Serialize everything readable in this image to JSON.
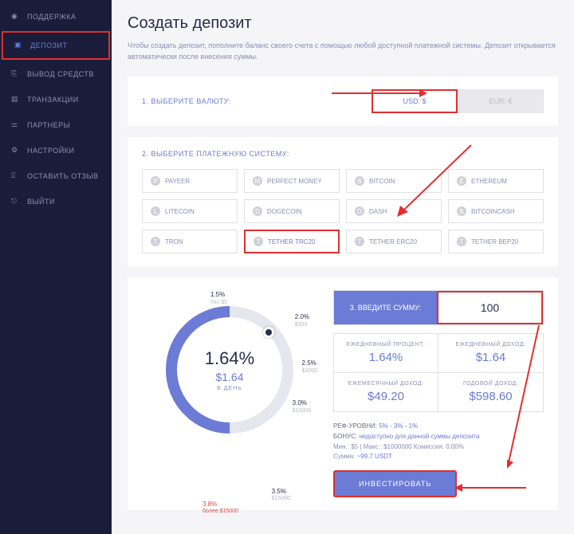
{
  "sidebar": {
    "items": [
      {
        "label": "ПОДДЕРЖКА",
        "icon": "headset"
      },
      {
        "label": "ДЕПОЗИТ",
        "icon": "deposit",
        "active": true
      },
      {
        "label": "ВЫВОД СРЕДСТВ",
        "icon": "withdraw"
      },
      {
        "label": "ТРАНЗАКЦИИ",
        "icon": "transactions"
      },
      {
        "label": "ПАРТНЕРЫ",
        "icon": "partners"
      },
      {
        "label": "НАСТРОЙКИ",
        "icon": "settings"
      },
      {
        "label": "ОСТАВИТЬ ОТЗЫВ",
        "icon": "review"
      },
      {
        "label": "ВЫЙТИ",
        "icon": "logout"
      }
    ]
  },
  "page": {
    "title": "Создать депозит",
    "subtitle": "Чтобы создать депозит, пополните баланс своего счета с помощью любой доступной платежной системы. Депозит открывается автоматически после внесения суммы."
  },
  "step1": {
    "label": "1. ВЫБЕРИТЕ ВАЛЮТУ:",
    "usd": "USD: $",
    "eur": "EUR: €"
  },
  "step2": {
    "label": "2. ВЫБЕРИТЕ ПЛАТЕЖНУЮ СИСТЕМУ:",
    "items": [
      "PAYEER",
      "PERFECT MONEY",
      "BITCOIN",
      "ETHEREUM",
      "LITECOIN",
      "DOGECOIN",
      "DASH",
      "BITCOINCASH",
      "TRON",
      "TETHER TRC20",
      "TETHER ERC20",
      "TETHER BEP20"
    ],
    "icons": [
      "P",
      "M",
      "B",
      "E",
      "L",
      "D",
      "D",
      "B",
      "T",
      "T",
      "T",
      "T"
    ],
    "selected_index": 9
  },
  "step3": {
    "label": "3. ВВЕДИТЕ СУММУ:",
    "amount": "100"
  },
  "gauge": {
    "percent": "1.64%",
    "amount": "$1.64",
    "per_day": "В ДЕНЬ",
    "ticks": [
      {
        "p": "1.5%",
        "v": "min $5"
      },
      {
        "p": "2.0%",
        "v": "$300"
      },
      {
        "p": "2.5%",
        "v": "$3000"
      },
      {
        "p": "3.0%",
        "v": "$10000"
      },
      {
        "p": "3.5%",
        "v": "$15000"
      },
      {
        "p": "3.8%",
        "v": "более $15000"
      }
    ]
  },
  "stats": {
    "daily_pct_l": "ЕЖЕДНЕВНЫЙ ПРОЦЕНТ:",
    "daily_pct_v": "1.64%",
    "daily_inc_l": "ЕЖЕДНЕВНЫЙ ДОХОД:",
    "daily_inc_v": "$1.64",
    "monthly_l": "ЕЖЕМЕСЯЧНЫЙ ДОХОД:",
    "monthly_v": "$49.20",
    "yearly_l": "ГОДОВОЙ ДОХОД:",
    "yearly_v": "$598.60"
  },
  "info": {
    "ref_l": "РЕФ-УРОВНИ:",
    "ref_v": "5% - 3% - 1%",
    "bonus_l": "БОНУС:",
    "bonus_v": "недоступно для данной суммы депозита",
    "line3": "Мин.: $5 | Макс.: $1000000   Комиссия: 0.00%",
    "line4a": "Сумма:",
    "line4b": "~99.7 USDT"
  },
  "invest_btn": "ИНВЕСТИРОВАТЬ"
}
